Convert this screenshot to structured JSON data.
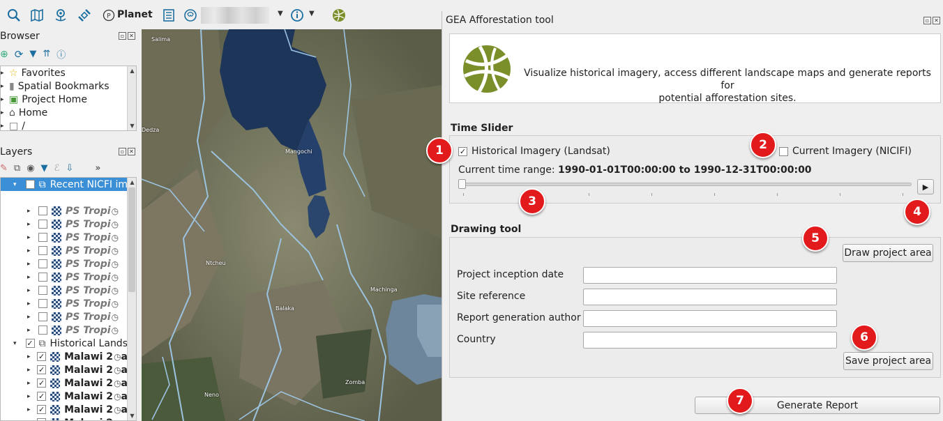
{
  "toolbar": {
    "planet_label": "Planet",
    "icons": [
      "search-icon",
      "map-icon",
      "pin-icon",
      "satellite-icon",
      "planet-logo-icon",
      "table-icon",
      "user-icon",
      "info-icon",
      "globe-icon"
    ]
  },
  "browser": {
    "title": "Browser",
    "items": [
      {
        "label": "Favorites",
        "icon": "star-icon"
      },
      {
        "label": "Spatial Bookmarks",
        "icon": "bookmark-icon"
      },
      {
        "label": "Project Home",
        "icon": "project-home-icon"
      },
      {
        "label": "Home",
        "icon": "home-folder-icon"
      },
      {
        "label": "/",
        "icon": "folder-icon"
      }
    ]
  },
  "layers": {
    "title": "Layers",
    "group1": "Recent NICFI im",
    "ps_items": [
      "PS Tropi",
      "PS Tropi",
      "PS Tropi",
      "PS Tropi",
      "PS Tropi",
      "PS Tropi",
      "PS Tropi",
      "PS Tropi",
      "PS Tropi",
      "PS Tropi"
    ],
    "group2": "Historical Lands",
    "malawi_items": [
      "Malawi 2",
      "Malawi 2",
      "Malawi 2",
      "Malawi 2",
      "Malawi 2",
      "Malawi 2"
    ],
    "malawi_suffix": "a"
  },
  "map": {
    "towns": [
      "Salima",
      "Dedza",
      "Mangochi",
      "Ntcheu",
      "Machinga",
      "Balaka",
      "Zomba",
      "Neno"
    ]
  },
  "plugin": {
    "title": "GEA Afforestation tool",
    "description_line1": "Visualize historical imagery, access different landscape maps and generate reports for",
    "description_line2": "potential afforestation sites.",
    "time_slider": {
      "section": "Time Slider",
      "historical_label": "Historical Imagery (Landsat)",
      "historical_checked": true,
      "current_label": "Current Imagery (NICIFI)",
      "current_checked": false,
      "range_prefix": "Current time range:",
      "range_value": "1990-01-01T00:00:00 to 1990-12-31T00:00:00",
      "slider_position": 0
    },
    "drawing_tool": {
      "section": "Drawing tool",
      "draw_button": "Draw project area",
      "fields": [
        {
          "label": "Project inception date",
          "value": ""
        },
        {
          "label": "Site reference",
          "value": ""
        },
        {
          "label": "Report generation author",
          "value": ""
        },
        {
          "label": "Country",
          "value": ""
        }
      ],
      "save_button": "Save project area"
    },
    "generate_button": "Generate Report"
  },
  "callouts": [
    "1",
    "2",
    "3",
    "4",
    "5",
    "6",
    "7"
  ],
  "colors": {
    "callout": "#e31a1c",
    "accent": "#1b6e9f",
    "selection": "#3b8fd6",
    "logo_green": "#7a8f2a"
  }
}
